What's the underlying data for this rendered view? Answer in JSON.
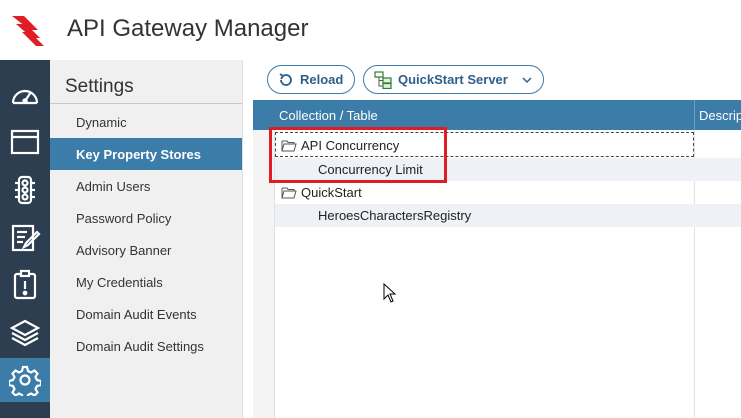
{
  "app": {
    "title": "API Gateway Manager"
  },
  "rail": {
    "items": [
      {
        "icon": "dashboard-icon"
      },
      {
        "icon": "window-icon"
      },
      {
        "icon": "traffic-light-icon"
      },
      {
        "icon": "edit-document-icon"
      },
      {
        "icon": "clipboard-alert-icon"
      },
      {
        "icon": "layers-icon"
      },
      {
        "icon": "gear-icon"
      }
    ],
    "active": 6
  },
  "settings": {
    "title": "Settings",
    "items": [
      {
        "label": "Dynamic"
      },
      {
        "label": "Key Property Stores"
      },
      {
        "label": "Admin Users"
      },
      {
        "label": "Password Policy"
      },
      {
        "label": "Advisory Banner"
      },
      {
        "label": "My Credentials"
      },
      {
        "label": "Domain Audit Events"
      },
      {
        "label": "Domain Audit Settings"
      }
    ],
    "active_index": 1
  },
  "toolbar": {
    "reload_label": "Reload",
    "quickstart_label": "QuickStart Server"
  },
  "grid": {
    "columns": [
      {
        "label": "Collection / Table"
      },
      {
        "label": "Descrip"
      }
    ],
    "rows": [
      {
        "label": "API Concurrency",
        "type": "collection"
      },
      {
        "label": "Concurrency Limit",
        "type": "table"
      },
      {
        "label": "QuickStart",
        "type": "collection"
      },
      {
        "label": "HeroesCharactersRegistry",
        "type": "table"
      }
    ]
  },
  "colors": {
    "accent": "#3b7ca8",
    "rail": "#2c3e50",
    "highlight": "#e11d24",
    "logo": "#e11d24"
  }
}
